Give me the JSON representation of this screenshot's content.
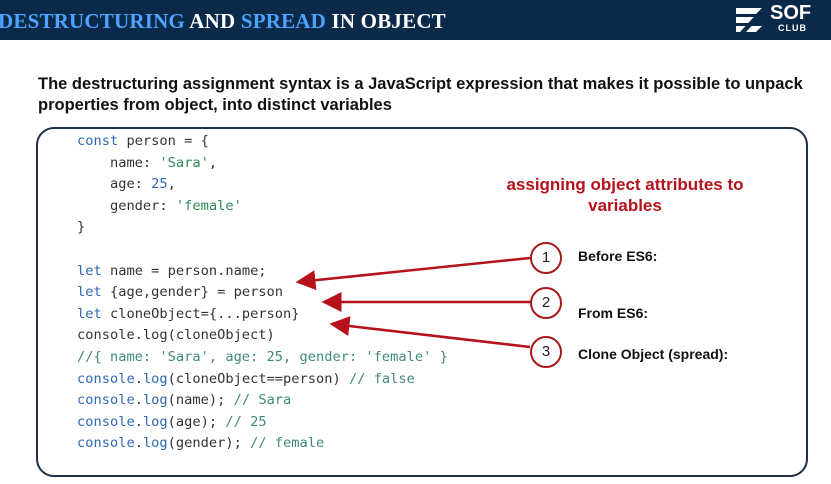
{
  "header": {
    "title_part1": "DESTRUCTURING",
    "title_part2": " AND ",
    "title_part3": "SPREAD",
    "title_part4": "  IN OBJECT",
    "logo_text": "SOF",
    "logo_sub": "CLUB",
    "colors": {
      "background": "#0b2a4a",
      "highlight": "#4da3ff"
    }
  },
  "intro": "The destructuring assignment syntax is a JavaScript expression that makes it possible to unpack properties from object, into distinct variables",
  "code_lines": [
    [
      [
        "kw",
        "const"
      ],
      [
        "t",
        " person = {"
      ]
    ],
    [
      [
        "t",
        "    name: "
      ],
      [
        "str",
        "'Sara'"
      ],
      [
        "t",
        ","
      ]
    ],
    [
      [
        "t",
        "    age: "
      ],
      [
        "num",
        "25"
      ],
      [
        "t",
        ","
      ]
    ],
    [
      [
        "t",
        "    gender: "
      ],
      [
        "str",
        "'female'"
      ]
    ],
    [
      [
        "t",
        "}"
      ]
    ],
    [
      [
        "t",
        ""
      ]
    ],
    [
      [
        "kw",
        "let"
      ],
      [
        "t",
        " name = person.name;"
      ]
    ],
    [
      [
        "kw",
        "let"
      ],
      [
        "t",
        " {age,gender} = person"
      ]
    ],
    [
      [
        "kw",
        "let"
      ],
      [
        "t",
        " cloneObject={...person}"
      ]
    ],
    [
      [
        "t",
        "console.log(cloneObject)"
      ]
    ],
    [
      [
        "cm",
        "//{ name: 'Sara', age: 25, gender: 'female' }"
      ]
    ],
    [
      [
        "kw",
        "console"
      ],
      [
        "t",
        "."
      ],
      [
        "kw",
        "log"
      ],
      [
        "t",
        "(cloneObject==person) "
      ],
      [
        "cm",
        "// false"
      ]
    ],
    [
      [
        "kw",
        "console"
      ],
      [
        "t",
        "."
      ],
      [
        "kw",
        "log"
      ],
      [
        "t",
        "(name); "
      ],
      [
        "cm",
        "// Sara"
      ]
    ],
    [
      [
        "kw",
        "console"
      ],
      [
        "t",
        "."
      ],
      [
        "kw",
        "log"
      ],
      [
        "t",
        "(age); "
      ],
      [
        "cm",
        "// 25"
      ]
    ],
    [
      [
        "kw",
        "console"
      ],
      [
        "t",
        "."
      ],
      [
        "kw",
        "log"
      ],
      [
        "t",
        "(gender); "
      ],
      [
        "cm",
        "// female"
      ]
    ]
  ],
  "annotation": {
    "title": "assigning object attributes to variables",
    "items": [
      {
        "number": "1",
        "label": "Before ES6:"
      },
      {
        "number": "2",
        "label": "From ES6:"
      },
      {
        "number": "3",
        "label": "Clone Object (spread):"
      }
    ],
    "color": "#b5121b"
  }
}
